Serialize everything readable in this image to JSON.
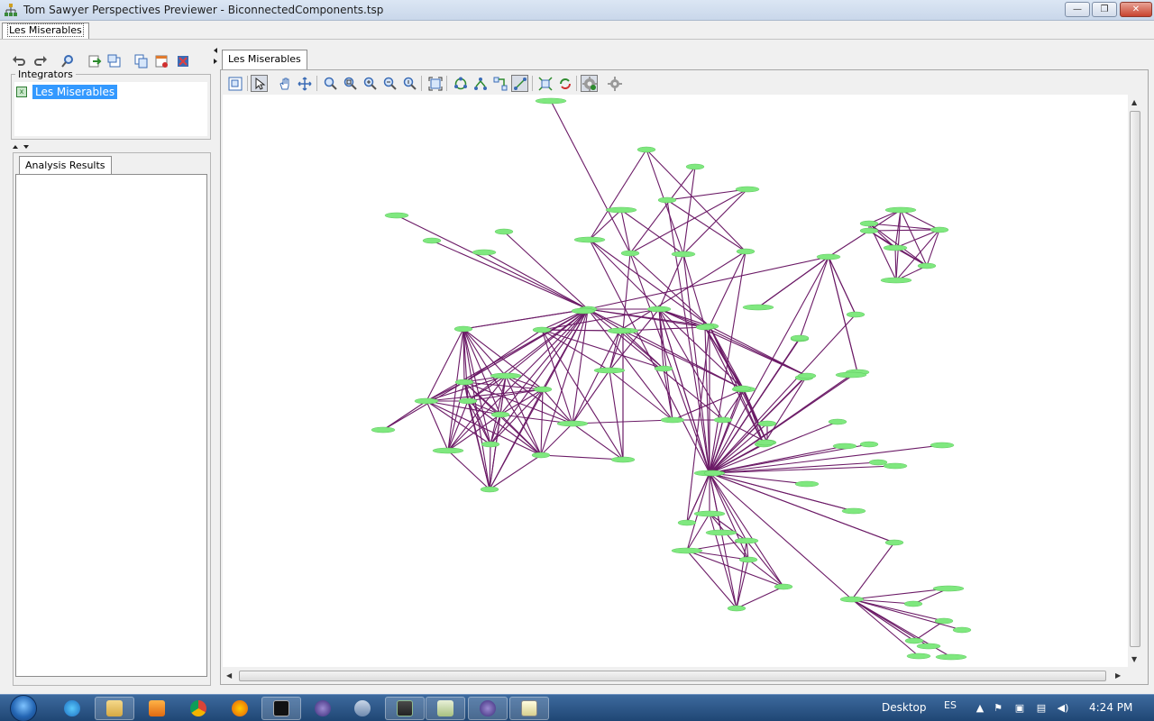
{
  "window": {
    "title": "Tom Sawyer Perspectives Previewer - BiconnectedComponents.tsp",
    "minimize_glyph": "—",
    "maximize_glyph": "❐",
    "close_glyph": "✕"
  },
  "doc_tab": {
    "label": "Les Miserables"
  },
  "left_panel": {
    "integrators_label": "Integrators",
    "integrator_item": "Les Miserables",
    "results_tab": "Analysis Results"
  },
  "graph_panel": {
    "tab_label": "Les Miserables"
  },
  "taskbar": {
    "desktop_label": "Desktop",
    "language": "ES",
    "clock": "4:24 PM"
  },
  "icons": {
    "undo": "undo-icon",
    "redo": "redo-icon",
    "search": "search-icon",
    "node_color": "#7fe87f",
    "edge_color": "#6b1a66"
  }
}
